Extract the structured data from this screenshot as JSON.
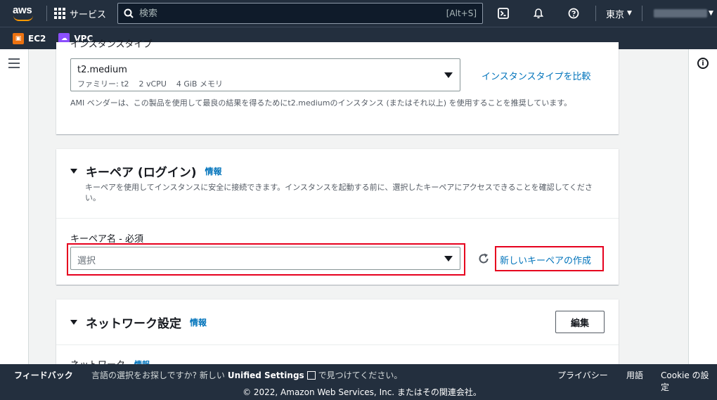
{
  "topnav": {
    "logo_text": "aws",
    "services_label": "サービス",
    "search_placeholder": "検索",
    "search_shortcut": "[Alt+S]",
    "region_label": "東京"
  },
  "favorites": [
    {
      "label": "EC2",
      "color": "#ec7211"
    },
    {
      "label": "VPC",
      "color": "#8c4fff"
    }
  ],
  "instance_type": {
    "clipped_label": "インスタンスタイプ",
    "selected": "t2.medium",
    "details": "ファミリー: t2    2 vCPU    4 GiB メモリ",
    "compare_link": "インスタンスタイプを比較",
    "hint": "AMI ベンダーは、この製品を使用して最良の結果を得るためにt2.mediumのインスタンス (またはそれ以上) を使用することを推奨しています。"
  },
  "keypair": {
    "title": "キーペア (ログイン)",
    "info": "情報",
    "description": "キーペアを使用してインスタンスに安全に接続できます。インスタンスを起動する前に、選択したキーペアにアクセスできることを確認してください。",
    "field_label": "キーペア名 - 必須",
    "placeholder": "選択",
    "create_link": "新しいキーペアの作成"
  },
  "network": {
    "title": "ネットワーク設定",
    "info": "情報",
    "edit_button": "編集",
    "field_label": "ネットワーク",
    "field_info": "情報"
  },
  "footer": {
    "feedback": "フィードバック",
    "lang_prefix": "言語の選択をお探しですか? 新しい",
    "lang_bold": "Unified Settings",
    "lang_suffix": "で見つけてください。",
    "privacy": "プライバシー",
    "terms": "用語",
    "cookie": "Cookie の設定",
    "copyright": "© 2022, Amazon Web Services, Inc. またはその関連会社。"
  },
  "colors": {
    "nav_bg": "#232f3e",
    "link": "#0073bb",
    "highlight": "#e6001e"
  }
}
